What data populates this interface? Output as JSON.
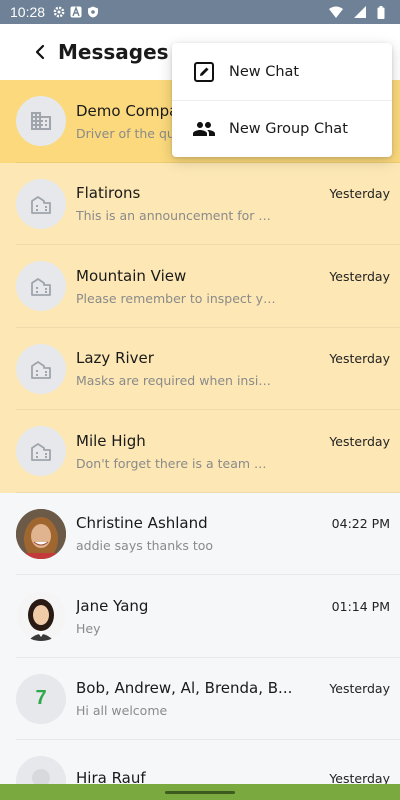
{
  "status_bar": {
    "time": "10:28",
    "icons": [
      "gear-icon",
      "a-icon",
      "shield-icon",
      "wifi-icon",
      "signal-icon",
      "battery-icon"
    ]
  },
  "header": {
    "title": "Messages",
    "back_icon": "chevron-left-icon"
  },
  "menu": {
    "items": [
      {
        "label": "New Chat",
        "icon": "edit-icon"
      },
      {
        "label": "New Group Chat",
        "icon": "group-icon"
      }
    ]
  },
  "conversations": [
    {
      "name": "Demo Company",
      "preview": "Driver of the quarter",
      "time": "",
      "avatar": "building-icon",
      "style": "selected"
    },
    {
      "name": "Flatirons",
      "preview": "This is an announcement for fl...",
      "time": "Yesterday",
      "avatar": "building-icon",
      "style": "bldg"
    },
    {
      "name": "Mountain View",
      "preview": "Please remember to inspect yo...",
      "time": "Yesterday",
      "avatar": "building-icon",
      "style": "bldg"
    },
    {
      "name": "Lazy River",
      "preview": "Masks are required when inside...",
      "time": "Yesterday",
      "avatar": "building-icon",
      "style": "bldg"
    },
    {
      "name": "Mile High",
      "preview": "Don't forget there is a team me...",
      "time": "Yesterday",
      "avatar": "building-icon",
      "style": "bldg"
    },
    {
      "name": "Christine Ashland",
      "preview": "addie says thanks too",
      "time": "04:22 PM",
      "avatar": "photo-christine",
      "style": "plain"
    },
    {
      "name": "Jane Yang",
      "preview": "Hey",
      "time": "01:14 PM",
      "avatar": "photo-jane",
      "style": "plain"
    },
    {
      "name": "Bob, Andrew, Al, Brenda, B...",
      "preview": "Hi all welcome",
      "time": "Yesterday",
      "avatar": "7",
      "style": "plain"
    },
    {
      "name": "Hira Rauf",
      "preview": "",
      "time": "Yesterday",
      "avatar": "person-icon",
      "style": "plain"
    }
  ],
  "colors": {
    "status_bar": "#6e8196",
    "selected_row": "#fbd97c",
    "building_row": "#fde8b5",
    "count_badge": "#2ea84b",
    "nav_bar": "#7aaa3f"
  }
}
